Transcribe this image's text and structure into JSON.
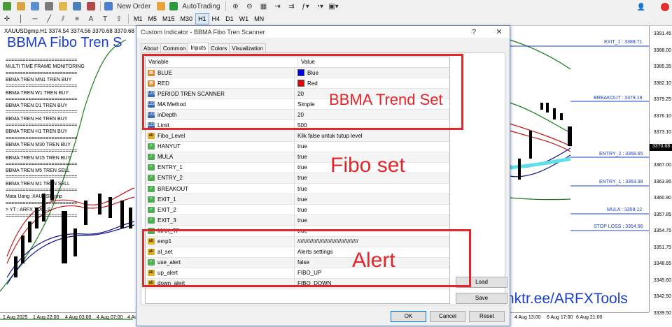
{
  "toolbar": {
    "new_order": "New Order",
    "auto_trading": "AutoTrading",
    "timeframes": [
      "M1",
      "M5",
      "M15",
      "M30",
      "H1",
      "H4",
      "D1",
      "W1",
      "MN"
    ],
    "active_timeframe": "H1"
  },
  "chart": {
    "symbol_info": "XAUUSDgmp.H1  3374.54 3374.56 3370.68 3370.68",
    "title": "BBMA Fibo Tren S",
    "status_lines": [
      "=========================",
      "MULTI TIME FRAME MONITORING",
      "=========================",
      "BBMA TREN MN1  TREN BUY",
      "=========================",
      "BBMA TREN W1 TREN  BUY",
      "=========================",
      "BBMA TREN D1 TREN  BUY",
      "=========================",
      "BBMA TREN H4 TREN  BUY",
      "=========================",
      "BBMA TREN H1 TREN  BUY",
      "=========================",
      "BBMA TREN M30 TREN  BUY",
      "=========================",
      "BBMA TREN M15 TREN  BUY",
      "=========================",
      "BBMA TREN M5  TREN  SELL",
      "=========================",
      "BBMA TREN M1  TREN  SELL",
      "=========================",
      "Mata Uang :XAUUSDgmp",
      "=========================",
      "> YT : ARFX TOOLS",
      "========================="
    ],
    "price_ticks": [
      "3391.45",
      "3388.00",
      "3385.35",
      "3382.10",
      "3379.25",
      "3376.10",
      "3373.10",
      "3370.68",
      "3367.00",
      "3363.95",
      "3360.90",
      "3357.85",
      "3354.75",
      "3351.75",
      "3348.65",
      "3345.60",
      "3342.50",
      "3339.50"
    ],
    "current_price": "3370.68",
    "time_ticks": [
      "1 Aug 2025",
      "1 Aug 22:00",
      "4 Aug 03:00",
      "4 Aug 07:00",
      "4 Aug 1",
      "4 Aug 13:00",
      "6 Aug 17:00",
      "6 Aug 21:00"
    ],
    "levels": {
      "exit1": "EXIT_1 : 3389.71",
      "breakout": "BREAKOUT : 3379.18",
      "entry2": "ENTRY_2 : 3368.65",
      "entry1": "ENTRY_1 : 3363.38",
      "mula": "MULA : 3358.12",
      "stoploss": "STOP LOSS : 3354.96"
    },
    "watermark": "nktr.ee/ARFXTools"
  },
  "dialog": {
    "title": "Custom Indicator - BBMA Fibo Tren Scanner",
    "help_symbol": "?",
    "close_symbol": "✕",
    "tabs": [
      "About",
      "Common",
      "Inputs",
      "Colors",
      "Visualization"
    ],
    "active_tab": "Inputs",
    "columns": {
      "variable": "Variable",
      "value": "Value"
    },
    "rows": [
      {
        "icon": "color",
        "var": "BLUE",
        "val": "Blue",
        "swatch": "#0000e0"
      },
      {
        "icon": "color",
        "var": "RED",
        "val": "Red",
        "swatch": "#e00000"
      },
      {
        "icon": "int",
        "var": "PERIOD TREN SCANNER",
        "val": "20"
      },
      {
        "icon": "int",
        "var": "MA Method",
        "val": "Simple"
      },
      {
        "icon": "int",
        "var": "inDepth",
        "val": "20"
      },
      {
        "icon": "int",
        "var": "Limit",
        "val": "500"
      },
      {
        "icon": "str",
        "var": "Fibo_Level",
        "val": "Klik false untuk tutup level"
      },
      {
        "icon": "bool",
        "var": "HANYUT",
        "val": "true"
      },
      {
        "icon": "bool",
        "var": "MULA",
        "val": "true"
      },
      {
        "icon": "bool",
        "var": "ENTRY_1",
        "val": "true"
      },
      {
        "icon": "bool",
        "var": "ENTRY_2",
        "val": "true"
      },
      {
        "icon": "bool",
        "var": "BREAKOUT",
        "val": "true"
      },
      {
        "icon": "bool",
        "var": "EXIT_1",
        "val": "true"
      },
      {
        "icon": "bool",
        "var": "EXIT_2",
        "val": "true"
      },
      {
        "icon": "bool",
        "var": "EXIT_3",
        "val": "true"
      },
      {
        "icon": "bool",
        "var": "MAX_TP",
        "val": "true"
      },
      {
        "icon": "str",
        "var": "emp1",
        "val": "///////////////////////////////////////"
      },
      {
        "icon": "str",
        "var": "al_set",
        "val": "Alerts settings"
      },
      {
        "icon": "bool",
        "var": "use_alert",
        "val": "false"
      },
      {
        "icon": "str",
        "var": "up_alert",
        "val": "FIBO_UP"
      },
      {
        "icon": "str",
        "var": "down_alert",
        "val": "FIBO_DOWN"
      }
    ],
    "load_label": "Load",
    "save_label": "Save",
    "ok_label": "OK",
    "cancel_label": "Cancel",
    "reset_label": "Reset"
  },
  "annotations": {
    "trend_set": "BBMA Trend Set",
    "fibo_set": "Fibo set",
    "alert": "Alert"
  },
  "colors": {
    "annotation": "#e3262a",
    "brand_blue": "#1a3fd0"
  }
}
